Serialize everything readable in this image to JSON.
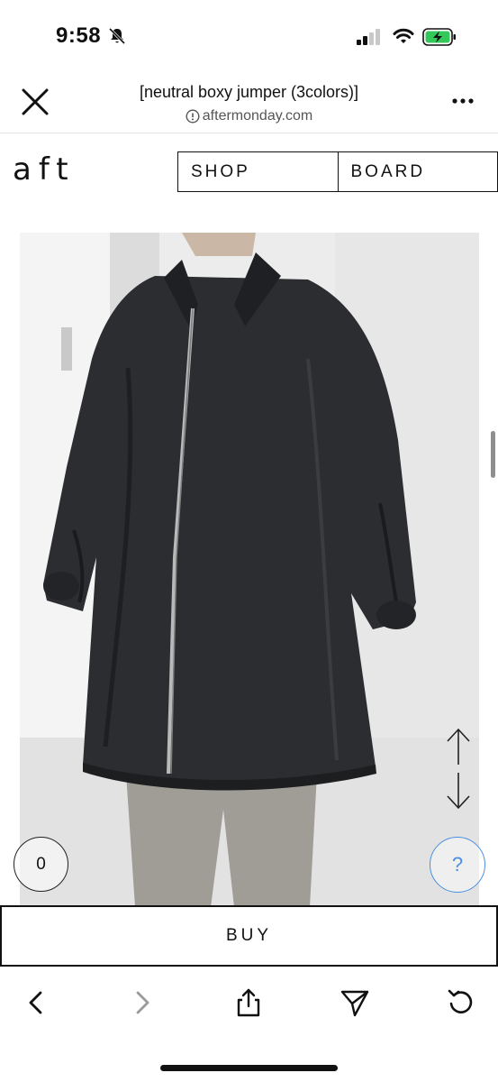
{
  "status_bar": {
    "time": "9:58",
    "icons": [
      "bell-slash-icon",
      "cellular-signal-icon",
      "wifi-icon",
      "battery-charging-icon"
    ]
  },
  "browser": {
    "title": "[neutral boxy jumper (3colors)]",
    "url": "aftermonday.com",
    "close_icon": "close-icon",
    "more_icon": "more-options-icon",
    "info_icon": "info-circle-icon"
  },
  "site": {
    "logo": "aft",
    "nav": [
      {
        "label": "SHOP"
      },
      {
        "label": "BOARD"
      }
    ]
  },
  "product": {
    "image_alt": "product-photo"
  },
  "floating": {
    "cart_count": "0",
    "help_label": "?",
    "scroll_up_icon": "arrow-up-icon",
    "scroll_down_icon": "arrow-down-icon"
  },
  "buy": {
    "label": "BUY"
  },
  "toolbar": {
    "items": [
      "back-icon",
      "forward-icon",
      "share-icon",
      "send-icon",
      "reload-icon"
    ]
  },
  "colors": {
    "accent_blue": "#4a8fe0",
    "battery_green": "#34c759",
    "text": "#111111"
  }
}
